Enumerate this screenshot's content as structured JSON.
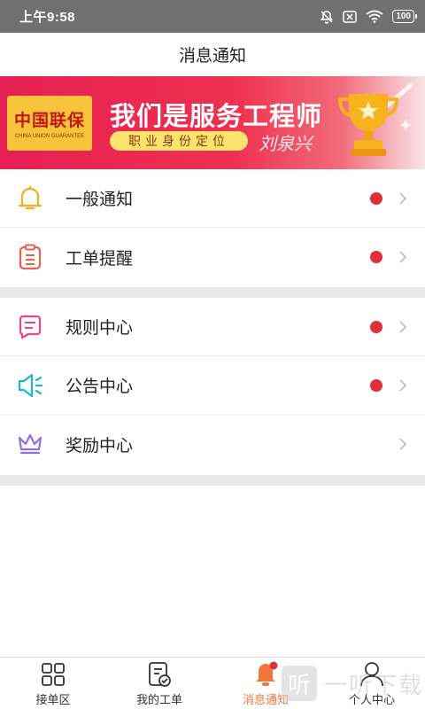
{
  "status_bar": {
    "time": "上午9:58",
    "battery": "100",
    "icons": [
      "bell-off-icon",
      "sim-x-icon",
      "wifi-icon",
      "battery-icon"
    ]
  },
  "header": {
    "title": "消息通知"
  },
  "banner": {
    "logo_cn": "中国联保",
    "logo_en": "CHINA UNION GUARANTEE",
    "headline": "我们是服务工程师",
    "subline": "职业身份定位",
    "signature": "刘泉兴",
    "colors": {
      "gradient_start": "#e61e52",
      "pill": "#fbe36e",
      "logo_bg": "#f6c33b"
    }
  },
  "groups": [
    {
      "items": [
        {
          "label": "一般通知",
          "icon": "bell-icon",
          "unread": true
        },
        {
          "label": "工单提醒",
          "icon": "clipboard-icon",
          "unread": true
        }
      ]
    },
    {
      "items": [
        {
          "label": "规则中心",
          "icon": "message-square-icon",
          "unread": true
        },
        {
          "label": "公告中心",
          "icon": "speaker-icon",
          "unread": true
        },
        {
          "label": "奖励中心",
          "icon": "crown-icon",
          "unread": false
        }
      ]
    }
  ],
  "tabbar": {
    "tabs": [
      {
        "label": "接单区",
        "icon": "grid-icon",
        "active": false
      },
      {
        "label": "我的工单",
        "icon": "order-check-icon",
        "active": false
      },
      {
        "label": "消息通知",
        "icon": "bell-filled-icon",
        "active": true
      },
      {
        "label": "个人中心",
        "icon": "person-icon",
        "active": false
      }
    ],
    "active_color": "#f0783c"
  },
  "watermark": {
    "glyph": "听",
    "text": "一听下载"
  },
  "colors": {
    "unread_dot": "#e0303a",
    "bell_icon": "#f2b01e",
    "clipboard_icon": "#e7624e",
    "rules_icon": "#e44a7a",
    "speaker_icon": "#1fb4d6",
    "crown_icon": "#8e6ee0"
  }
}
